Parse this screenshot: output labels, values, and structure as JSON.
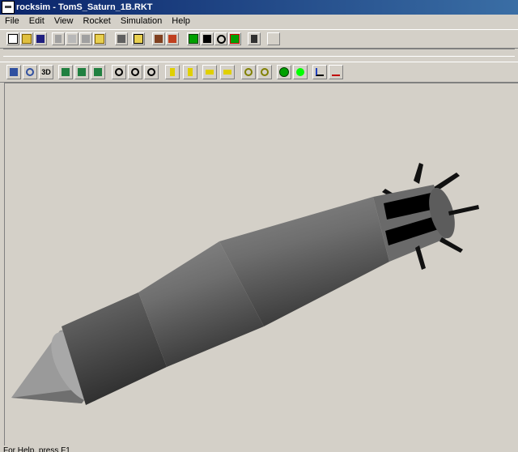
{
  "window": {
    "title": "rocksim - TomS_Saturn_1B.RKT"
  },
  "menu": [
    "File",
    "Edit",
    "View",
    "Rocket",
    "Simulation",
    "Help"
  ],
  "toolbar_view": {
    "three_d_label": "3D"
  },
  "status": {
    "text": "For Help, press F1"
  },
  "colors": {
    "title_start": "#0a246a",
    "title_end": "#3a6ea5",
    "face": "#d4d0c8",
    "rocket_gray": "#7a7a7a",
    "fin": "#111111"
  }
}
